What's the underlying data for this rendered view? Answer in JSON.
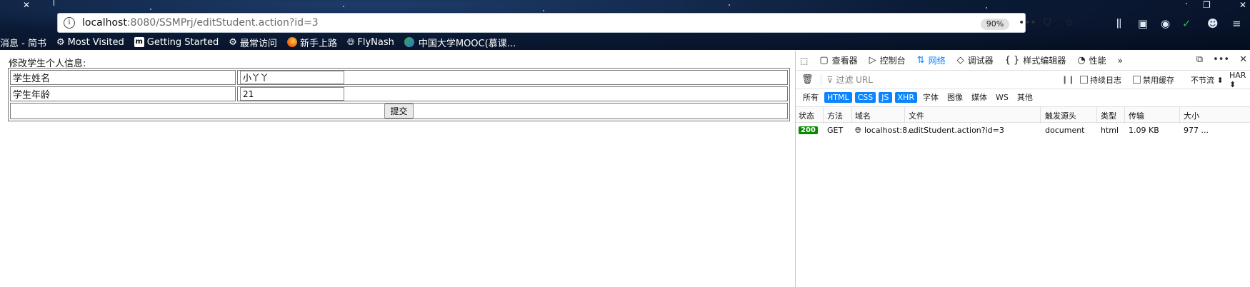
{
  "browser": {
    "url_host": "localhost",
    "url_path": ":8080/SSMPrj/editStudent.action?id=3",
    "zoom": "90%",
    "icons": [
      "close-icon",
      "info-icon",
      "more-icon",
      "pocket-icon",
      "bookmark-star-icon",
      "library-icon",
      "sidebar-icon",
      "sync-icon",
      "account-icon",
      "menu-icon"
    ]
  },
  "bookmarks": [
    {
      "label": "消息 - 简书",
      "icon": "jianshu-icon"
    },
    {
      "label": "Most Visited",
      "icon": "gear-icon"
    },
    {
      "label": "Getting Started",
      "icon": "m-icon"
    },
    {
      "label": "最常访问",
      "icon": "gear-icon"
    },
    {
      "label": "新手上路",
      "icon": "firefox-icon"
    },
    {
      "label": "FlyNash",
      "icon": "globe-icon"
    },
    {
      "label": "中国大学MOOC(慕课...",
      "icon": "mooc-icon"
    }
  ],
  "page": {
    "title": "修改学生个人信息:",
    "name_label": "学生姓名",
    "name_value": "小丫丫",
    "age_label": "学生年龄",
    "age_value": "21",
    "submit_label": "提交"
  },
  "devtools": {
    "tabs": [
      {
        "label": "查看器",
        "icon": "inspector-icon"
      },
      {
        "label": "控制台",
        "icon": "console-icon"
      },
      {
        "label": "网络",
        "icon": "network-icon",
        "active": true
      },
      {
        "label": "调试器",
        "icon": "debugger-icon"
      },
      {
        "label": "样式编辑器",
        "icon": "style-editor-icon"
      },
      {
        "label": "性能",
        "icon": "performance-icon"
      }
    ],
    "filter_placeholder": "过滤 URL",
    "persist_log": "持续日志",
    "disable_cache": "禁用缓存",
    "throttle": "不节流 ⬍",
    "har": "HAR ⬍",
    "type_filters": [
      {
        "label": "所有",
        "on": false
      },
      {
        "label": "HTML",
        "on": true
      },
      {
        "label": "CSS",
        "on": true
      },
      {
        "label": "JS",
        "on": true
      },
      {
        "label": "XHR",
        "on": true
      },
      {
        "label": "字体",
        "on": false
      },
      {
        "label": "图像",
        "on": false
      },
      {
        "label": "媒体",
        "on": false
      },
      {
        "label": "WS",
        "on": false
      },
      {
        "label": "其他",
        "on": false
      }
    ],
    "columns": [
      "状态",
      "方法",
      "域名",
      "文件",
      "触发源头",
      "类型",
      "传输",
      "大小"
    ],
    "request": {
      "status": "200",
      "method": "GET",
      "domain": "localhost:8...",
      "file": "editStudent.action?id=3",
      "cause": "document",
      "type": "html",
      "transferred": "1.09 KB",
      "size": "977 ..."
    }
  }
}
